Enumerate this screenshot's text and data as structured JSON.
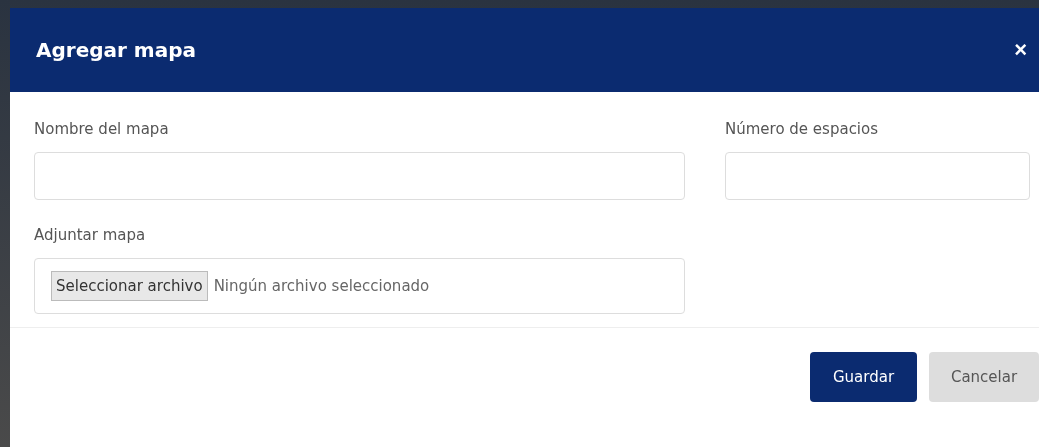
{
  "dialog": {
    "title": "Agregar mapa",
    "close": "×"
  },
  "fields": [
    {
      "label": "Nombre del mapa",
      "kind": "text"
    },
    {
      "label": "Número de espacios",
      "kind": "text"
    },
    {
      "label": "Adjuntar mapa",
      "kind": "file",
      "button": "Seleccionar archivo",
      "status": "Ningún archivo seleccionado"
    }
  ],
  "buttons": [
    {
      "label": "Guardar",
      "kind": "primary"
    },
    {
      "label": "Cancelar",
      "kind": "secondary"
    }
  ]
}
